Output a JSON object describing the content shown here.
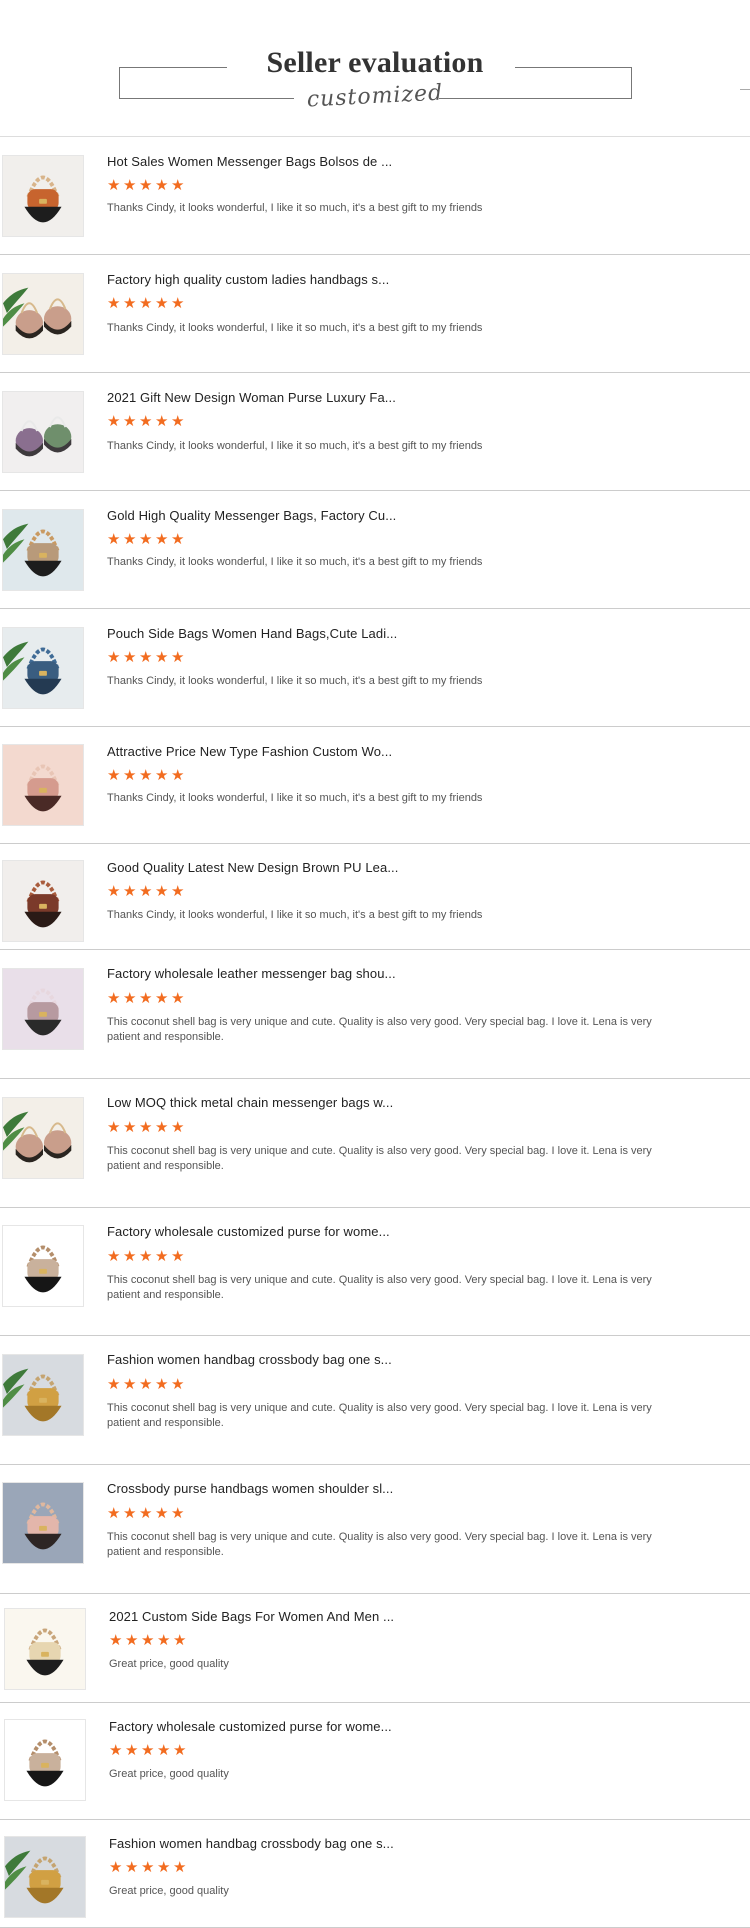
{
  "header": {
    "title": "Seller evaluation",
    "subtitle": "customized"
  },
  "colors": {
    "star": "#f26c20",
    "divider": "#cccccc"
  },
  "reviews": [
    {
      "title": "Hot Sales Women Messenger Bags Bolsos de ...",
      "rating": 5,
      "comment": "Thanks Cindy, it looks wonderful, I like it so much, it's a best gift to my friends",
      "thumb": "orange-bag"
    },
    {
      "title": "Factory high quality custom ladies handbags s...",
      "rating": 5,
      "comment": "Thanks Cindy, it looks wonderful, I like it so much, it's a best gift to my friends",
      "thumb": "pair-bags-plant"
    },
    {
      "title": "2021 Gift New Design Woman Purse Luxury Fa...",
      "rating": 5,
      "comment": "Thanks Cindy, it looks wonderful, I like it so much, it's a best gift to my friends",
      "thumb": "purple-green-bags"
    },
    {
      "title": "Gold High Quality Messenger Bags, Factory Cu...",
      "rating": 5,
      "comment": "Thanks Cindy, it looks wonderful, I like it so much, it's a best gift to my friends",
      "thumb": "gold-chain-bag"
    },
    {
      "title": "Pouch Side Bags Women Hand Bags,Cute Ladi...",
      "rating": 5,
      "comment": "Thanks Cindy, it looks wonderful, I like it so much, it's a best gift to my friends",
      "thumb": "blue-bag"
    },
    {
      "title": "Attractive Price New Type Fashion Custom Wo...",
      "rating": 5,
      "comment": "Thanks Cindy, it looks wonderful, I like it so much, it's a best gift to my friends",
      "thumb": "pink-bag"
    },
    {
      "title": "Good Quality Latest New Design Brown PU Lea...",
      "rating": 5,
      "comment": "Thanks Cindy, it looks wonderful, I like it so much, it's a best gift to my friends",
      "thumb": "brown-bag"
    },
    {
      "title": "Factory wholesale leather messenger bag shou...",
      "rating": 5,
      "comment": "This coconut shell bag is very unique and cute. Quality is also very good. Very special bag. I love it. Lena is very patient and responsible.",
      "thumb": "lilac-bag"
    },
    {
      "title": "Low MOQ thick metal chain messenger bags w...",
      "rating": 5,
      "comment": "This coconut shell bag is very unique and cute. Quality is also very good. Very special bag. I love it. Lena is very patient and responsible.",
      "thumb": "pair-bags-plant"
    },
    {
      "title": "Factory wholesale customized purse for wome...",
      "rating": 5,
      "comment": "This coconut shell bag is very unique and cute. Quality is also very good. Very special bag. I love it. Lena is very patient and responsible.",
      "thumb": "black-bag-white"
    },
    {
      "title": "Fashion women handbag crossbody bag one s...",
      "rating": 5,
      "comment": "This coconut shell bag is very unique and cute. Quality is also very good. Very special bag. I love it. Lena is very patient and responsible.",
      "thumb": "mustard-bag"
    },
    {
      "title": "Crossbody purse handbags women shoulder sl...",
      "rating": 5,
      "comment": "This coconut shell bag is very unique and cute. Quality is also very good. Very special bag. I love it. Lena is very patient and responsible.",
      "thumb": "pink-chain-bag"
    },
    {
      "title": "2021 Custom Side Bags For Women And Men ...",
      "rating": 5,
      "comment": "Great price, good quality",
      "thumb": "cream-gold-bag"
    },
    {
      "title": "Factory wholesale customized purse for wome...",
      "rating": 5,
      "comment": "Great price, good quality",
      "thumb": "black-bag-white"
    },
    {
      "title": "Fashion women handbag crossbody bag one s...",
      "rating": 5,
      "comment": "Great price, good quality",
      "thumb": "mustard-bag"
    }
  ]
}
